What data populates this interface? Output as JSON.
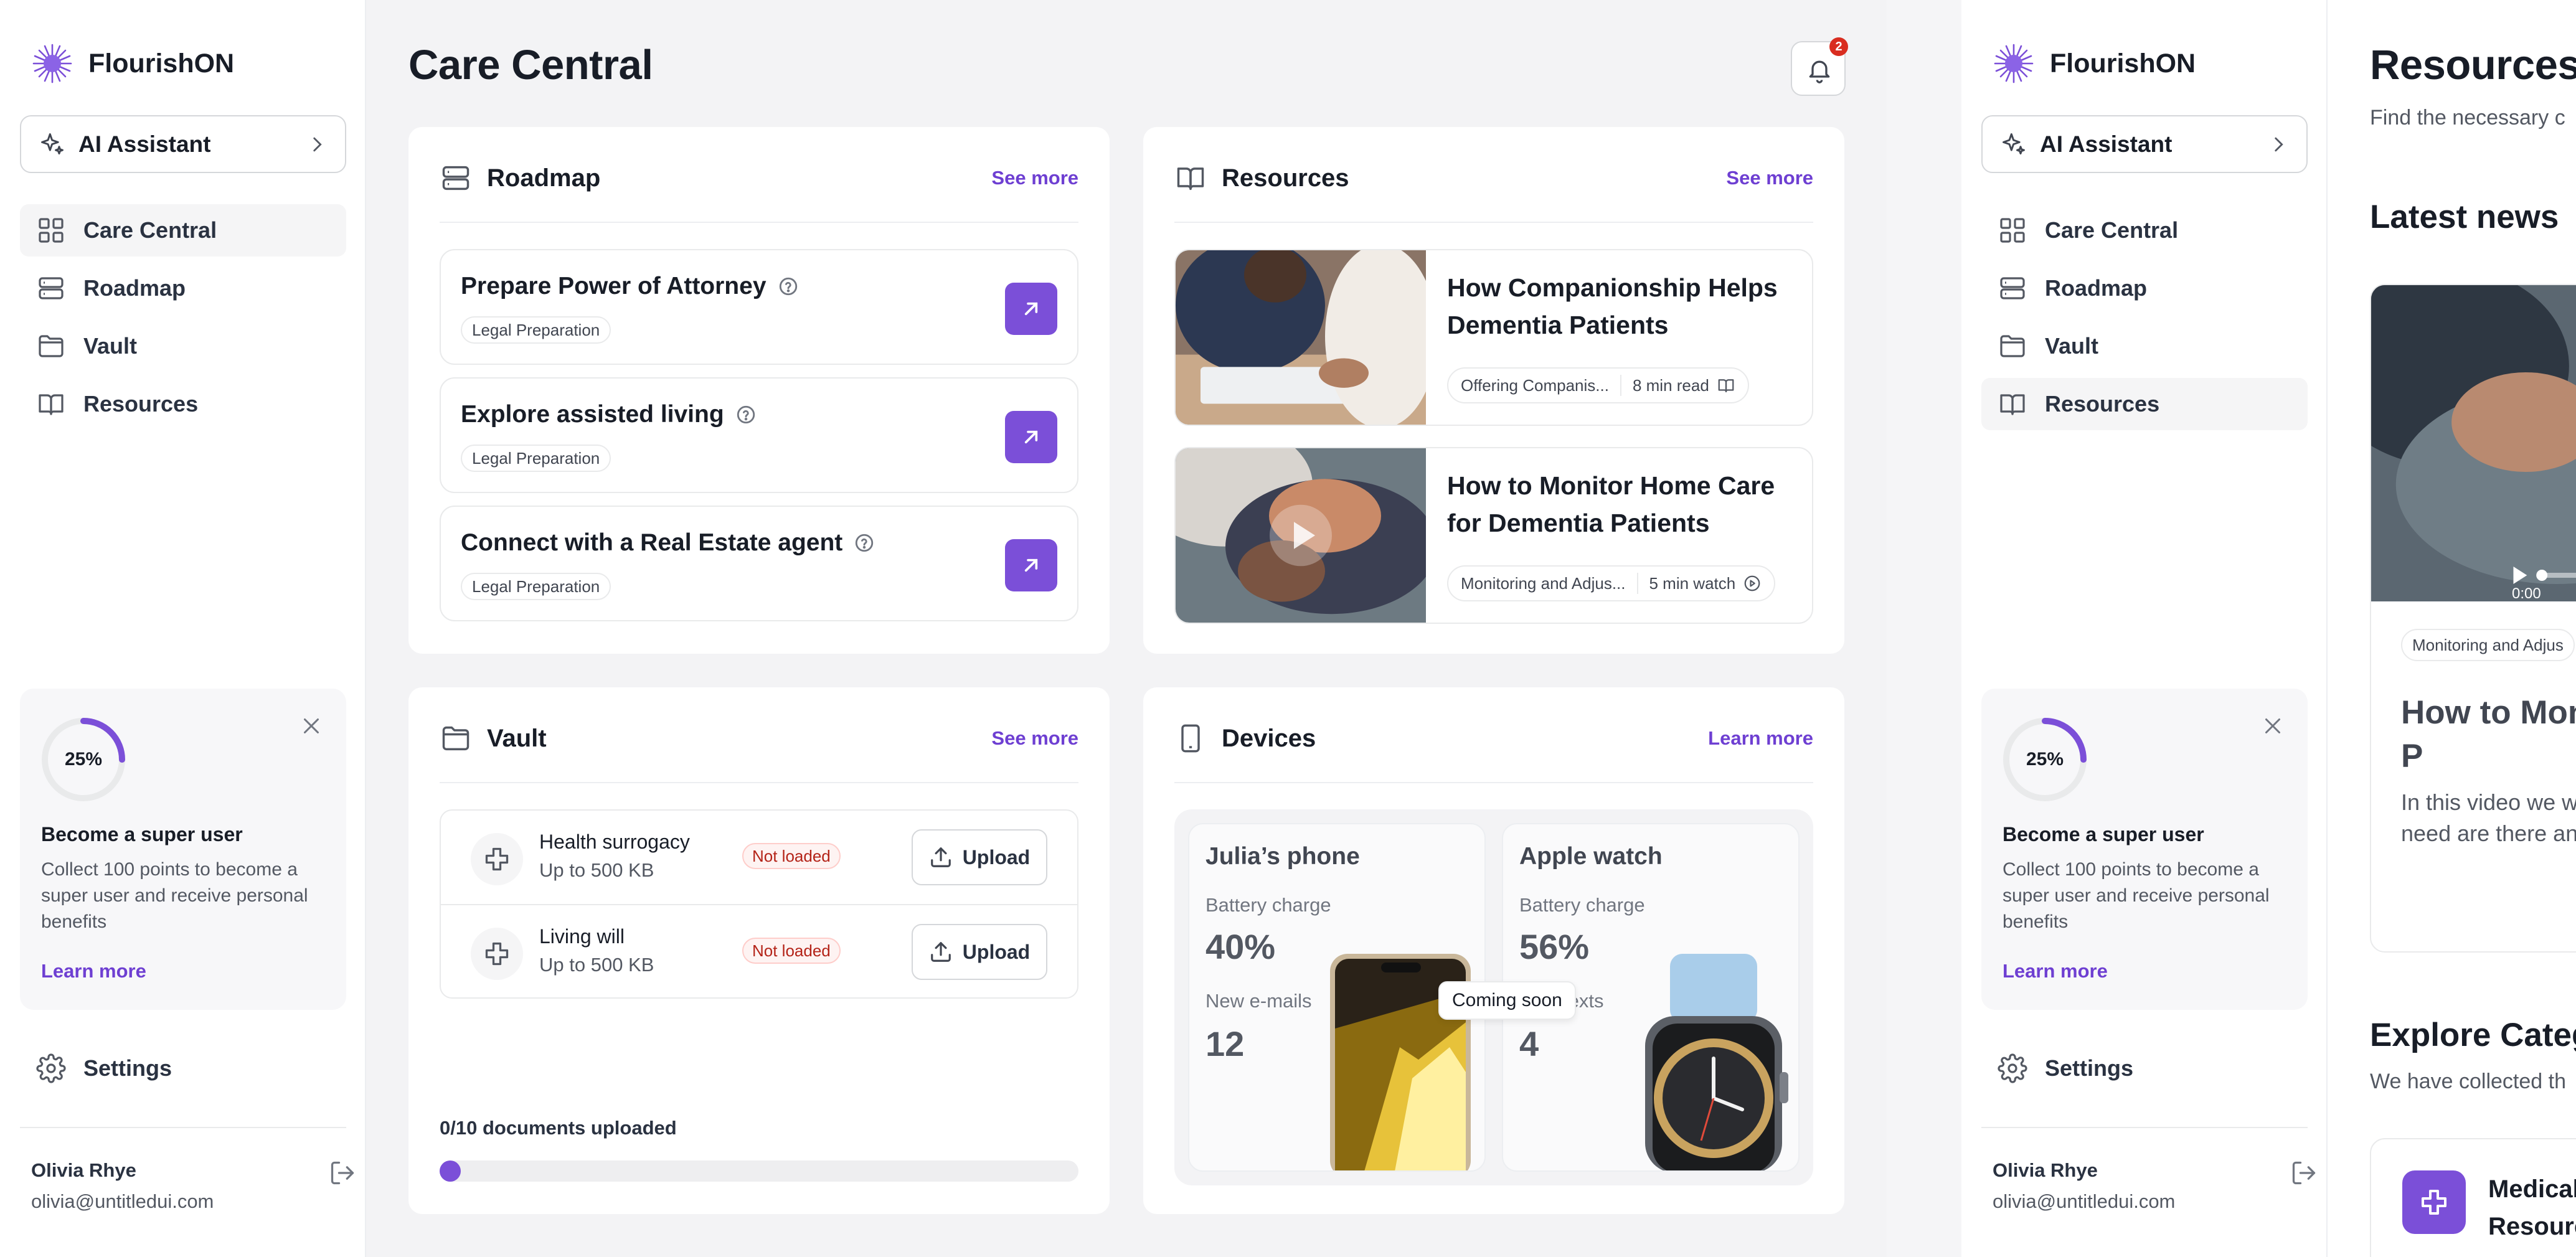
{
  "brand": {
    "name": "FlourishON"
  },
  "assistant": {
    "label": "AI Assistant"
  },
  "nav": {
    "items": [
      {
        "label": "Care Central",
        "icon": "grid-icon"
      },
      {
        "label": "Roadmap",
        "icon": "roadmap-icon"
      },
      {
        "label": "Vault",
        "icon": "folder-icon"
      },
      {
        "label": "Resources",
        "icon": "book-icon"
      }
    ],
    "active_screen1": "Care Central",
    "active_screen2": "Resources"
  },
  "promo": {
    "progress_label": "25%",
    "progress_value": 0.25,
    "title": "Become a super user",
    "description": "Collect 100 points to become a super user and receive personal benefits",
    "link": "Learn more"
  },
  "settings": {
    "label": "Settings"
  },
  "user": {
    "name": "Olivia Rhye",
    "email": "olivia@untitledui.com"
  },
  "header": {
    "title": "Care Central",
    "notification_count": "2"
  },
  "roadmap": {
    "title": "Roadmap",
    "see_more": "See more",
    "tasks": [
      {
        "title": "Prepare Power of Attorney",
        "tag": "Legal Preparation"
      },
      {
        "title": "Explore assisted living",
        "tag": "Legal Preparation"
      },
      {
        "title": "Connect with a Real Estate agent",
        "tag": "Legal Preparation"
      }
    ]
  },
  "resources": {
    "title": "Resources",
    "see_more": "See more",
    "items": [
      {
        "title": "How Companionship Helps Dementia Patients",
        "category": "Offering Companis...",
        "duration": "8 min read",
        "kind_icon": "book-icon"
      },
      {
        "title": "How to Monitor Home Care for Dementia Patients",
        "category": "Monitoring and Adjus...",
        "duration": "5 min watch",
        "kind_icon": "play-circle-icon"
      }
    ]
  },
  "vault": {
    "title": "Vault",
    "see_more": "See more",
    "documents": [
      {
        "name": "Health surrogacy",
        "limit": "Up to 500 KB",
        "status": "Not loaded",
        "action": "Upload"
      },
      {
        "name": "Living will",
        "limit": "Up to 500 KB",
        "status": "Not loaded",
        "action": "Upload"
      }
    ],
    "progress_text": "0/10 documents uploaded",
    "progress_value": 0
  },
  "devices": {
    "title": "Devices",
    "learn_more": "Learn more",
    "coming_soon": "Coming soon",
    "items": [
      {
        "name": "Julia’s phone",
        "label1": "Battery charge",
        "value1": "40%",
        "label2": "New e-mails",
        "value2": "12"
      },
      {
        "name": "Apple watch",
        "label1": "Battery charge",
        "value1": "56%",
        "label2": "texts",
        "value2": "4"
      }
    ]
  },
  "screen2": {
    "title": "Resources",
    "subtitle": "Find the necessary c",
    "latest_heading": "Latest news",
    "video_time": "0:00",
    "news_chip": "Monitoring and Adjus",
    "news_title": "How to Mon Dementia P",
    "news_desc": "In this video we w and why you need are there and whi this video",
    "explore_heading": "Explore Categ",
    "explore_sub": "We have collected th",
    "category_name": "Medical Resourc"
  },
  "colors": {
    "accent": "#7b4fd8",
    "accent_text": "#6e3fd2",
    "danger": "#d92d20",
    "not_loaded_bg": "#fef3f2",
    "not_loaded_text": "#b42318"
  }
}
